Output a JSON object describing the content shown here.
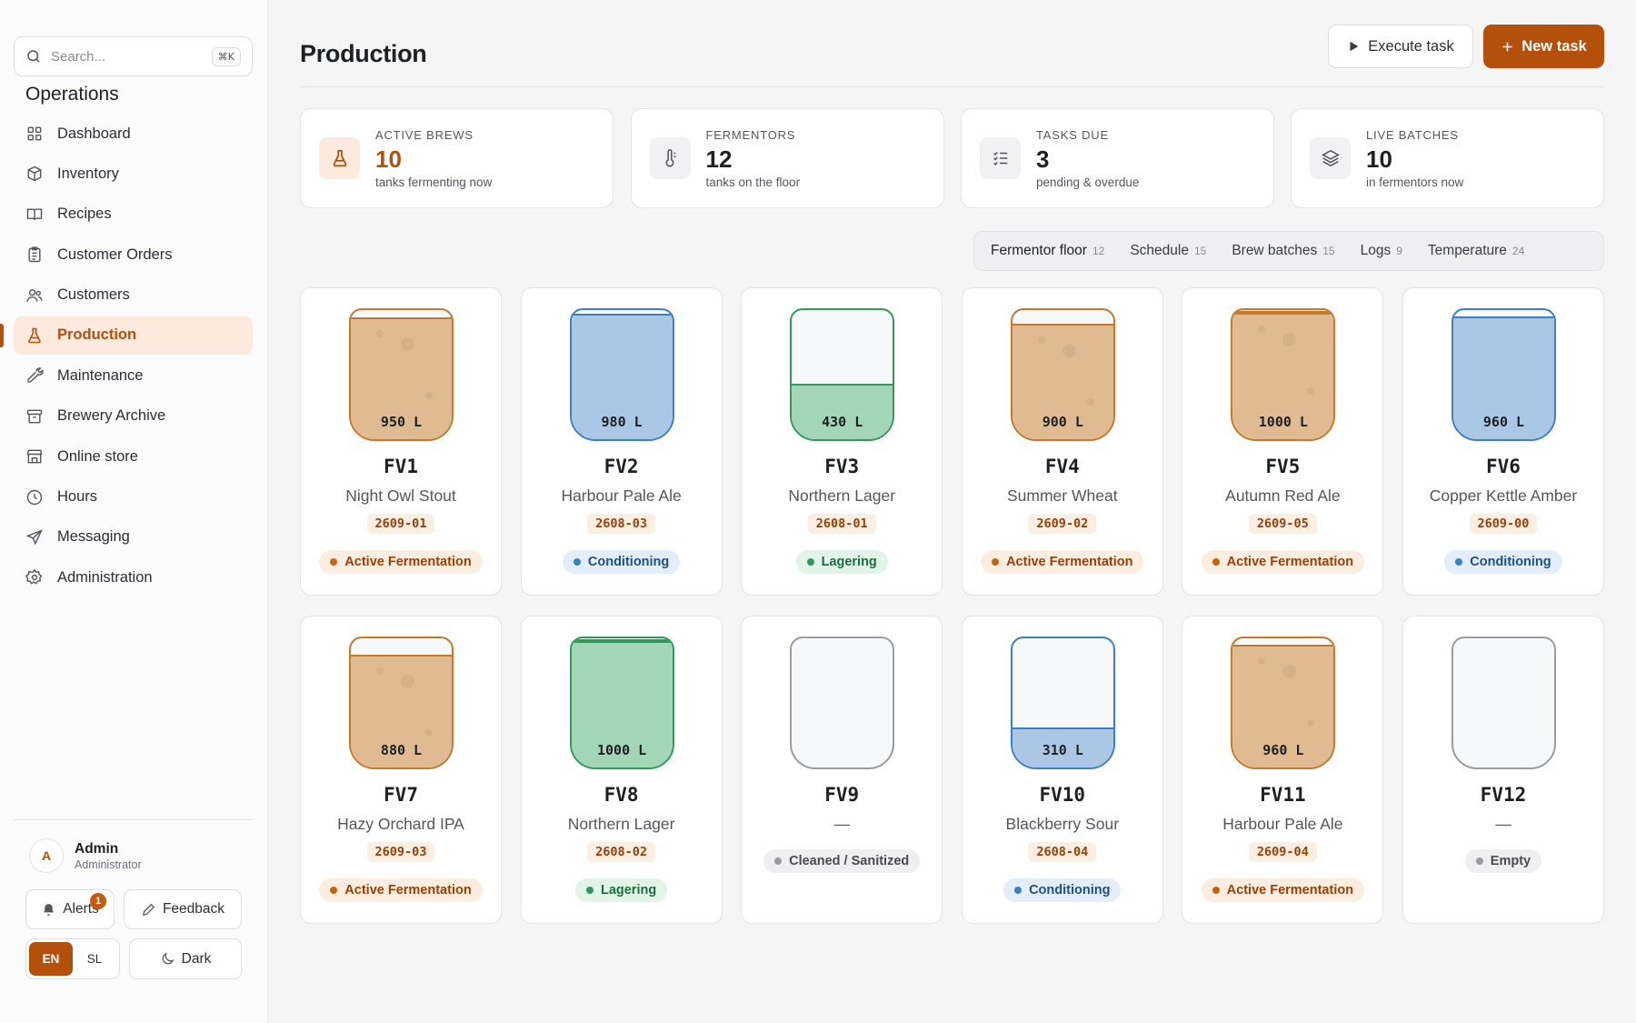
{
  "sidebar": {
    "search_placeholder": "Search...",
    "search_shortcut": "⌘K",
    "section_title": "Operations",
    "items": [
      {
        "label": "Dashboard",
        "icon": "dashboard-icon"
      },
      {
        "label": "Inventory",
        "icon": "box-icon"
      },
      {
        "label": "Recipes",
        "icon": "book-icon"
      },
      {
        "label": "Customer Orders",
        "icon": "clipboard-icon"
      },
      {
        "label": "Customers",
        "icon": "users-icon"
      },
      {
        "label": "Production",
        "icon": "flask-icon",
        "active": true
      },
      {
        "label": "Maintenance",
        "icon": "wrench-icon"
      },
      {
        "label": "Brewery Archive",
        "icon": "archive-icon"
      },
      {
        "label": "Online store",
        "icon": "store-icon"
      },
      {
        "label": "Hours",
        "icon": "clock-icon"
      },
      {
        "label": "Messaging",
        "icon": "send-icon"
      },
      {
        "label": "Administration",
        "icon": "gear-icon"
      }
    ],
    "user": {
      "initial": "A",
      "name": "Admin",
      "role": "Administrator"
    },
    "alerts_label": "Alerts",
    "alerts_count": "1",
    "feedback_label": "Feedback",
    "lang_en": "EN",
    "lang_sl": "SL",
    "dark_label": "Dark"
  },
  "header": {
    "title": "Production",
    "execute_label": "Execute task",
    "new_label": "New task"
  },
  "stats": [
    {
      "label": "ACTIVE BREWS",
      "value": "10",
      "sub": "tanks fermenting now"
    },
    {
      "label": "FERMENTORS",
      "value": "12",
      "sub": "tanks on the floor"
    },
    {
      "label": "TASKS DUE",
      "value": "3",
      "sub": "pending & overdue"
    },
    {
      "label": "LIVE BATCHES",
      "value": "10",
      "sub": "in fermentors now"
    }
  ],
  "tabs": [
    {
      "label": "Fermentor floor",
      "count": "12",
      "active": true
    },
    {
      "label": "Schedule",
      "count": "15"
    },
    {
      "label": "Brew batches",
      "count": "15"
    },
    {
      "label": "Logs",
      "count": "9"
    },
    {
      "label": "Temperature",
      "count": "24"
    }
  ],
  "colors": {
    "accent": "#b3500b",
    "active_tank": "#c27a2c",
    "active_fill": "#e0bb91",
    "conditioning_tank": "#3e7fc1",
    "conditioning_fill": "#aac8e6",
    "lagering_tank": "#2f9a5c",
    "lagering_fill": "#a3d6b6",
    "empty_tank": "#9a9ca3"
  },
  "fermentors": [
    {
      "name": "FV1",
      "beer": "Night Owl Stout",
      "batch": "2609-01",
      "volume": "950 L",
      "fill": 0.95,
      "status": "Active Fermentation",
      "kind": "active"
    },
    {
      "name": "FV2",
      "beer": "Harbour Pale Ale",
      "batch": "2608-03",
      "volume": "980 L",
      "fill": 0.98,
      "status": "Conditioning",
      "kind": "conditioning"
    },
    {
      "name": "FV3",
      "beer": "Northern Lager",
      "batch": "2608-01",
      "volume": "430 L",
      "fill": 0.43,
      "status": "Lagering",
      "kind": "lagering"
    },
    {
      "name": "FV4",
      "beer": "Summer Wheat",
      "batch": "2609-02",
      "volume": "900 L",
      "fill": 0.9,
      "status": "Active Fermentation",
      "kind": "active"
    },
    {
      "name": "FV5",
      "beer": "Autumn Red Ale",
      "batch": "2609-05",
      "volume": "1000 L",
      "fill": 1.0,
      "status": "Active Fermentation",
      "kind": "active"
    },
    {
      "name": "FV6",
      "beer": "Copper Kettle Amber",
      "batch": "2609-00",
      "volume": "960 L",
      "fill": 0.96,
      "status": "Conditioning",
      "kind": "conditioning"
    },
    {
      "name": "FV7",
      "beer": "Hazy Orchard IPA",
      "batch": "2609-03",
      "volume": "880 L",
      "fill": 0.88,
      "status": "Active Fermentation",
      "kind": "active"
    },
    {
      "name": "FV8",
      "beer": "Northern Lager",
      "batch": "2608-02",
      "volume": "1000 L",
      "fill": 1.0,
      "status": "Lagering",
      "kind": "lagering"
    },
    {
      "name": "FV9",
      "beer": "—",
      "batch": "",
      "volume": "",
      "fill": 0,
      "status": "Cleaned / Sanitized",
      "kind": "empty"
    },
    {
      "name": "FV10",
      "beer": "Blackberry Sour",
      "batch": "2608-04",
      "volume": "310 L",
      "fill": 0.31,
      "status": "Conditioning",
      "kind": "conditioning"
    },
    {
      "name": "FV11",
      "beer": "Harbour Pale Ale",
      "batch": "2609-04",
      "volume": "960 L",
      "fill": 0.96,
      "status": "Active Fermentation",
      "kind": "active"
    },
    {
      "name": "FV12",
      "beer": "—",
      "batch": "",
      "volume": "",
      "fill": 0,
      "status": "Empty",
      "kind": "empty"
    }
  ]
}
